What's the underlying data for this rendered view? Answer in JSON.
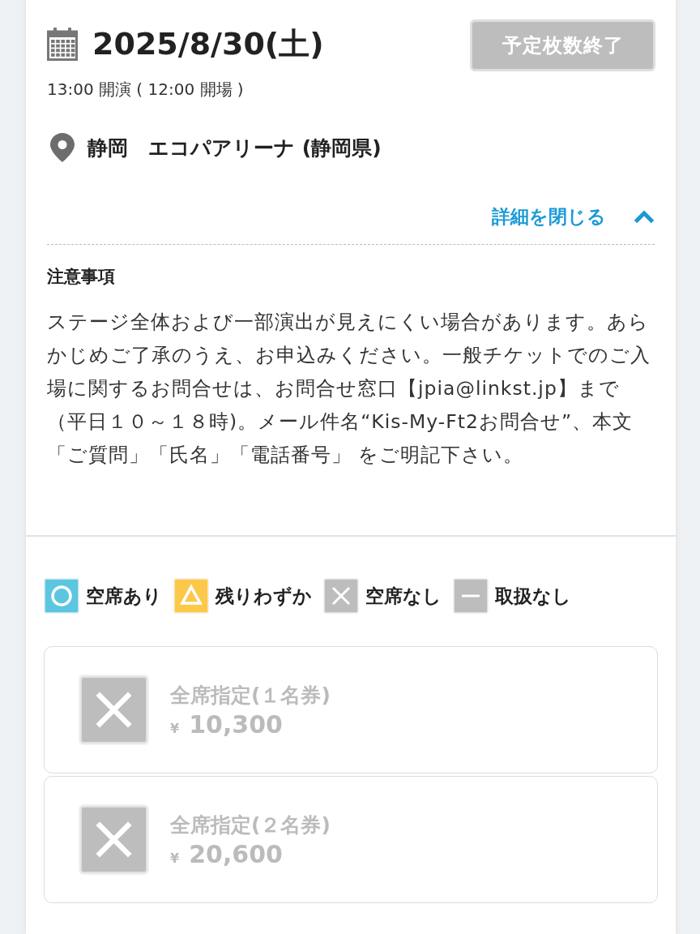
{
  "performance": {
    "date": "2025/8/30(土)",
    "status_button": {
      "label": "予定枚数終了",
      "disabled": true
    },
    "time": "13:00 開演 ( 12:00 開場 )",
    "venue": "静岡　エコパアリーナ (静岡県)",
    "details_toggle": {
      "label": "詳細を閉じる",
      "expanded": true
    }
  },
  "notice": {
    "title": "注意事項",
    "body": "ステージ全体および一部演出が見えにくい場合があります。あらかじめご了承のうえ、お申込みください。一般チケットでのご入場に関するお問合せは、お問合せ窓口【jpia@linkst.jp】まで（平日１０～１８時)。メール件名“Kis-My-Ft2お問合せ”、本文「ご質問」「氏名」「電話番号」 をご明記下さい。"
  },
  "legend": [
    {
      "kind": "available",
      "label": "空席あり",
      "color": "#5bc6e0"
    },
    {
      "kind": "few",
      "label": "残りわずか",
      "color": "#fcc84a"
    },
    {
      "kind": "none",
      "label": "空席なし",
      "color": "#bdbdbd"
    },
    {
      "kind": "unavailable",
      "label": "取扱なし",
      "color": "#bdbdbd"
    }
  ],
  "tickets": [
    {
      "name": "全席指定(１名券)",
      "currency": "¥",
      "price": "10,300",
      "kind": "none"
    },
    {
      "name": "全席指定(２名券)",
      "currency": "¥",
      "price": "20,600",
      "kind": "none"
    }
  ]
}
